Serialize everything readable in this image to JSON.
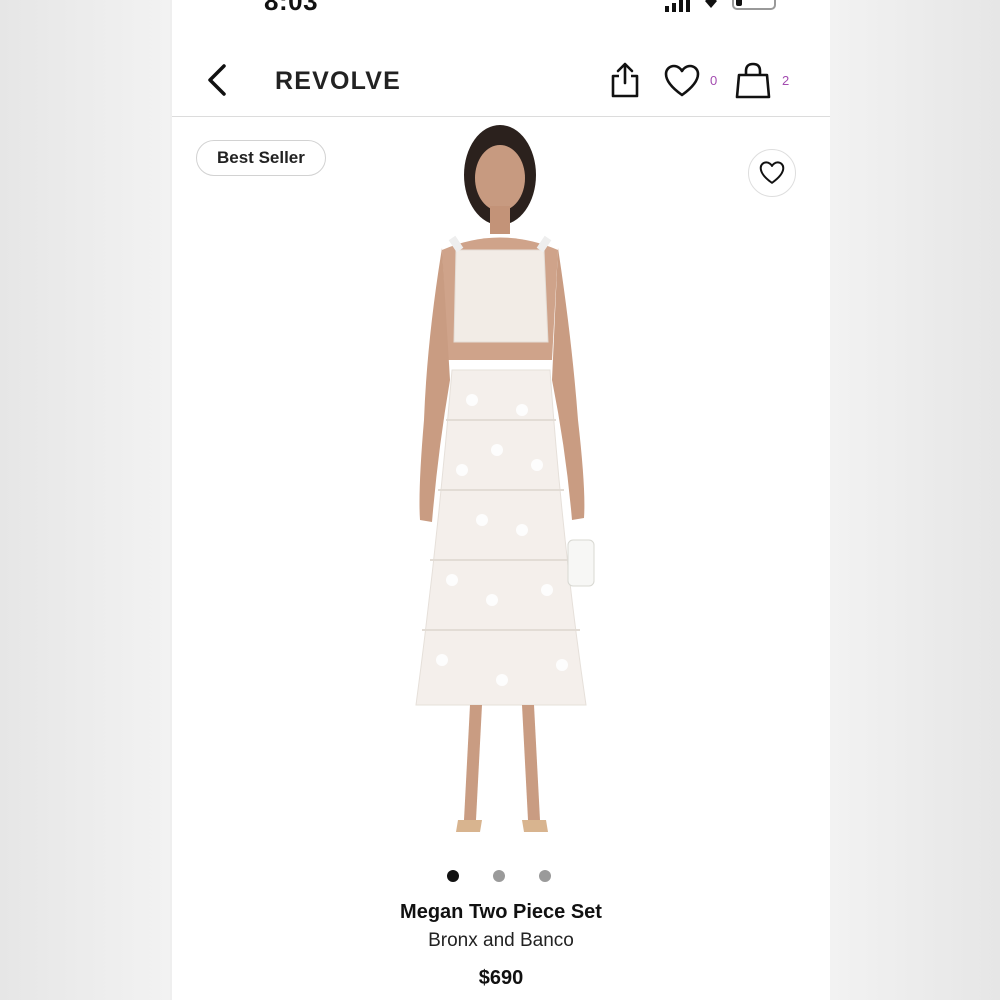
{
  "status_bar": {
    "time": "8:03"
  },
  "nav": {
    "brand": "REVOLVE",
    "wishlist_count": "0",
    "bag_count": "2",
    "icons": [
      "back-chevron-icon",
      "share-icon",
      "heart-icon",
      "shopping-bag-icon"
    ]
  },
  "product": {
    "badge": "Best Seller",
    "name": "Megan Two Piece Set",
    "brand": "Bronx and Banco",
    "price": "$690",
    "image_count": 3,
    "active_image_index": 0
  },
  "colors": {
    "accent_count": "#a34bb0",
    "text": "#111111",
    "divider": "#dcdcdc"
  }
}
